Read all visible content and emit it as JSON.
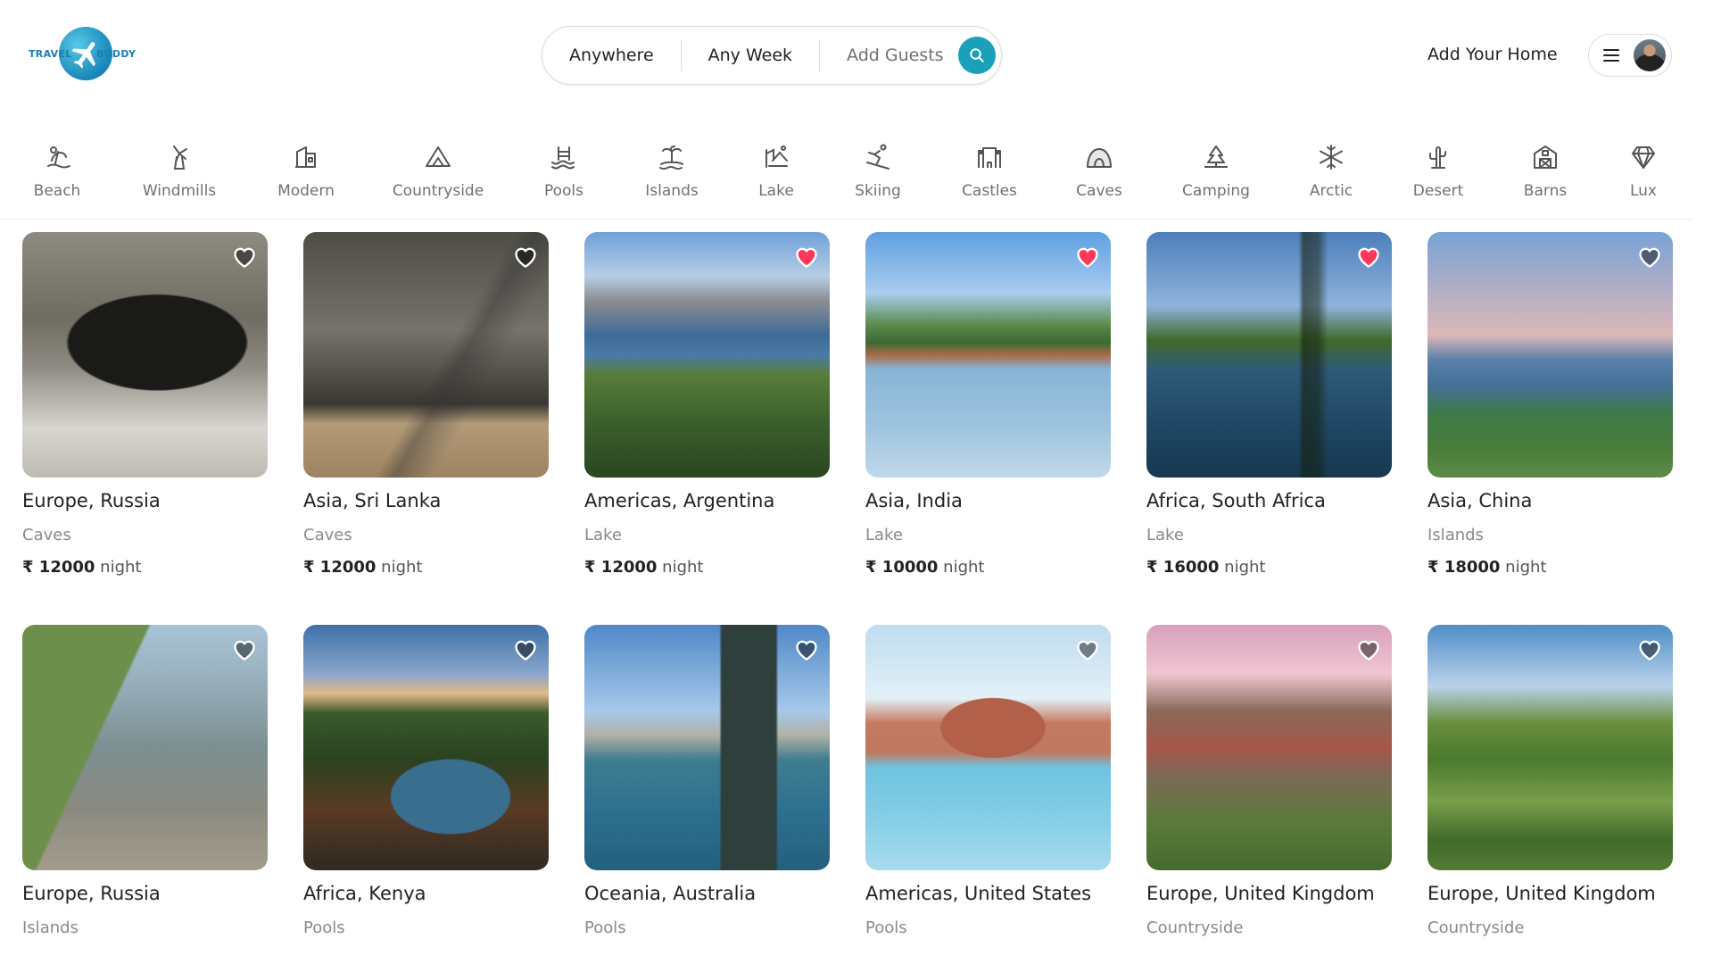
{
  "brand": {
    "left": "TRAVEL",
    "right": "BUDDY"
  },
  "search": {
    "where": "Anywhere",
    "when": "Any Week",
    "guests": "Add Guests",
    "button_icon": "search-icon",
    "accent": "#1aa0b8"
  },
  "header": {
    "add_home": "Add Your Home",
    "menu_icon": "hamburger-icon"
  },
  "categories": [
    {
      "label": "Beach",
      "icon": "beach-icon"
    },
    {
      "label": "Windmills",
      "icon": "windmill-icon"
    },
    {
      "label": "Modern",
      "icon": "modern-building-icon"
    },
    {
      "label": "Countryside",
      "icon": "mountain-icon"
    },
    {
      "label": "Pools",
      "icon": "pool-icon"
    },
    {
      "label": "Islands",
      "icon": "island-icon"
    },
    {
      "label": "Lake",
      "icon": "lake-icon"
    },
    {
      "label": "Skiing",
      "icon": "skiing-icon"
    },
    {
      "label": "Castles",
      "icon": "castle-icon"
    },
    {
      "label": "Caves",
      "icon": "cave-icon"
    },
    {
      "label": "Camping",
      "icon": "camping-icon"
    },
    {
      "label": "Arctic",
      "icon": "snowflake-icon"
    },
    {
      "label": "Desert",
      "icon": "cactus-icon"
    },
    {
      "label": "Barns",
      "icon": "barn-icon"
    },
    {
      "label": "Lux",
      "icon": "diamond-icon"
    }
  ],
  "listings": [
    {
      "title": "Europe, Russia",
      "category": "Caves",
      "price": "₹ 12000",
      "unit": "night",
      "favorite": false
    },
    {
      "title": "Asia, Sri Lanka",
      "category": "Caves",
      "price": "₹ 12000",
      "unit": "night",
      "favorite": false
    },
    {
      "title": "Americas, Argentina",
      "category": "Lake",
      "price": "₹ 12000",
      "unit": "night",
      "favorite": true
    },
    {
      "title": "Asia, India",
      "category": "Lake",
      "price": "₹ 10000",
      "unit": "night",
      "favorite": true
    },
    {
      "title": "Africa, South Africa",
      "category": "Lake",
      "price": "₹ 16000",
      "unit": "night",
      "favorite": true
    },
    {
      "title": "Asia, China",
      "category": "Islands",
      "price": "₹ 18000",
      "unit": "night",
      "favorite": false
    },
    {
      "title": "Europe, Russia",
      "category": "Islands",
      "price": "",
      "unit": "",
      "favorite": false
    },
    {
      "title": "Africa, Kenya",
      "category": "Pools",
      "price": "",
      "unit": "",
      "favorite": false
    },
    {
      "title": "Oceania, Australia",
      "category": "Pools",
      "price": "",
      "unit": "",
      "favorite": false
    },
    {
      "title": "Americas, United States",
      "category": "Pools",
      "price": "",
      "unit": "",
      "favorite": false
    },
    {
      "title": "Europe, United Kingdom",
      "category": "Countryside",
      "price": "",
      "unit": "",
      "favorite": false
    },
    {
      "title": "Europe, United Kingdom",
      "category": "Countryside",
      "price": "",
      "unit": "",
      "favorite": false
    }
  ],
  "colors": {
    "favorite": "#ff385c",
    "heart_outline": "#ffffff"
  }
}
